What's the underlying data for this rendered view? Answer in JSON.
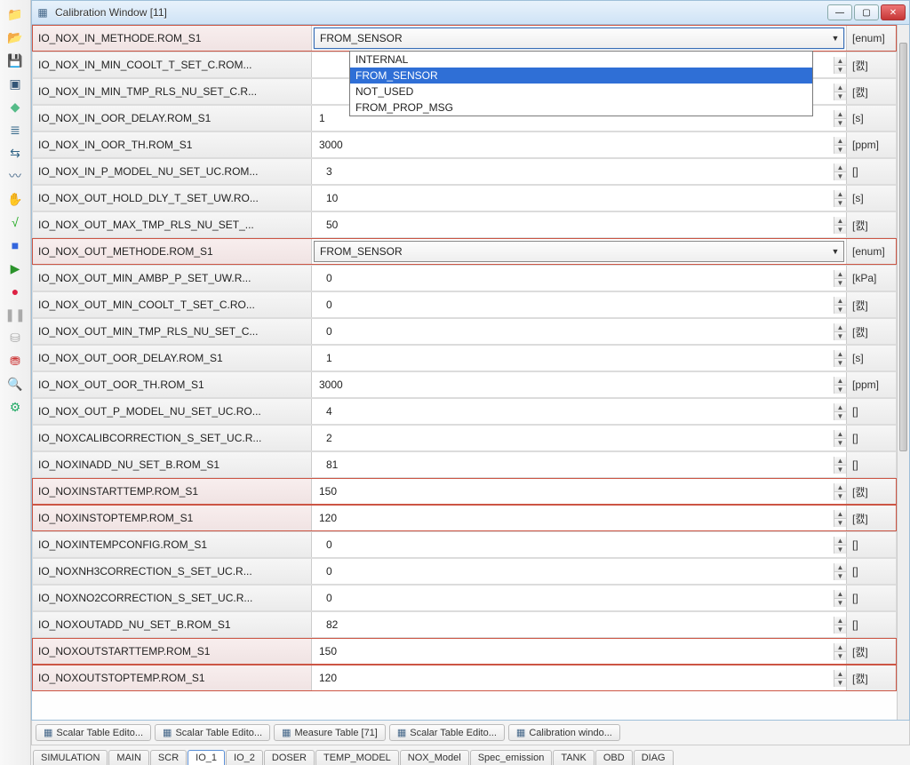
{
  "window": {
    "title": "Calibration Window [11]"
  },
  "toolbar_icons": [
    {
      "name": "folder-icon",
      "glyph": "📁",
      "cls": "ico-folder"
    },
    {
      "name": "folder-open-icon",
      "glyph": "📂",
      "cls": "ico-folder"
    },
    {
      "name": "save-icon",
      "glyph": "💾",
      "cls": "ico-save"
    },
    {
      "name": "monitor-icon",
      "glyph": "▣",
      "cls": "ico-monitor"
    },
    {
      "name": "chip-icon",
      "glyph": "◆",
      "cls": "ico-chip"
    },
    {
      "name": "list-icon",
      "glyph": "≣",
      "cls": "ico-list"
    },
    {
      "name": "tree-icon",
      "glyph": "⇆",
      "cls": "ico-tree"
    },
    {
      "name": "wave-icon",
      "glyph": "〰",
      "cls": "ico-wave"
    },
    {
      "name": "hand-icon",
      "glyph": "✋",
      "cls": "ico-hand"
    },
    {
      "name": "check-icon",
      "glyph": "√",
      "cls": "ico-check"
    },
    {
      "name": "square-icon",
      "glyph": "■",
      "cls": "ico-square"
    },
    {
      "name": "play-icon",
      "glyph": "▶",
      "cls": "ico-play"
    },
    {
      "name": "record-icon",
      "glyph": "●",
      "cls": "ico-record"
    },
    {
      "name": "pause-icon",
      "glyph": "❚❚",
      "cls": "ico-pause"
    },
    {
      "name": "disk-icon",
      "glyph": "⛁",
      "cls": "ico-disk1"
    },
    {
      "name": "disk-red-icon",
      "glyph": "⛃",
      "cls": "ico-disk2"
    },
    {
      "name": "search-icon",
      "glyph": "🔍",
      "cls": "ico-search"
    },
    {
      "name": "gear-icon",
      "glyph": "⚙",
      "cls": "ico-gear"
    }
  ],
  "dropdown": {
    "options": [
      "INTERNAL",
      "FROM_SENSOR",
      "NOT_USED",
      "FROM_PROP_MSG"
    ],
    "selected_index": 1
  },
  "rows": [
    {
      "label": "IO_NOX_IN_METHODE.ROM_S1",
      "type": "combo",
      "value": "FROM_SENSOR",
      "unit": "[enum]",
      "hl": true,
      "open": true
    },
    {
      "label": "IO_NOX_IN_MIN_COOLT_T_SET_C.ROM...",
      "type": "num",
      "value": "",
      "unit": "[캜]",
      "hl": false
    },
    {
      "label": "IO_NOX_IN_MIN_TMP_RLS_NU_SET_C.R...",
      "type": "num",
      "value": "",
      "unit": "[캜]",
      "hl": false
    },
    {
      "label": "IO_NOX_IN_OOR_DELAY.ROM_S1",
      "type": "num",
      "value": "1",
      "unit": "[s]",
      "hl": false
    },
    {
      "label": "IO_NOX_IN_OOR_TH.ROM_S1",
      "type": "num",
      "value": "3000",
      "unit": "[ppm]",
      "hl": false
    },
    {
      "label": "IO_NOX_IN_P_MODEL_NU_SET_UC.ROM...",
      "type": "num",
      "value": "3",
      "unit": "[]",
      "hl": false,
      "indent": true
    },
    {
      "label": "IO_NOX_OUT_HOLD_DLY_T_SET_UW.RO...",
      "type": "num",
      "value": "10",
      "unit": "[s]",
      "hl": false,
      "indent": true
    },
    {
      "label": "IO_NOX_OUT_MAX_TMP_RLS_NU_SET_...",
      "type": "num",
      "value": "50",
      "unit": "[캜]",
      "hl": false,
      "indent": true
    },
    {
      "label": "IO_NOX_OUT_METHODE.ROM_S1",
      "type": "combo",
      "value": "FROM_SENSOR",
      "unit": "[enum]",
      "hl": true
    },
    {
      "label": "IO_NOX_OUT_MIN_AMBP_P_SET_UW.R...",
      "type": "num",
      "value": "0",
      "unit": "[kPa]",
      "hl": false,
      "indent": true
    },
    {
      "label": "IO_NOX_OUT_MIN_COOLT_T_SET_C.RO...",
      "type": "num",
      "value": "0",
      "unit": "[캜]",
      "hl": false,
      "indent": true
    },
    {
      "label": "IO_NOX_OUT_MIN_TMP_RLS_NU_SET_C...",
      "type": "num",
      "value": "0",
      "unit": "[캜]",
      "hl": false,
      "indent": true
    },
    {
      "label": "IO_NOX_OUT_OOR_DELAY.ROM_S1",
      "type": "num",
      "value": "1",
      "unit": "[s]",
      "hl": false,
      "indent": true
    },
    {
      "label": "IO_NOX_OUT_OOR_TH.ROM_S1",
      "type": "num",
      "value": "3000",
      "unit": "[ppm]",
      "hl": false
    },
    {
      "label": "IO_NOX_OUT_P_MODEL_NU_SET_UC.RO...",
      "type": "num",
      "value": "4",
      "unit": "[]",
      "hl": false,
      "indent": true
    },
    {
      "label": "IO_NOXCALIBCORRECTION_S_SET_UC.R...",
      "type": "num",
      "value": "2",
      "unit": "[]",
      "hl": false,
      "indent": true
    },
    {
      "label": "IO_NOXINADD_NU_SET_B.ROM_S1",
      "type": "num",
      "value": "81",
      "unit": "[]",
      "hl": false,
      "indent": true
    },
    {
      "label": "IO_NOXINSTARTTEMP.ROM_S1",
      "type": "num",
      "value": "150",
      "unit": "[캜]",
      "hl": true
    },
    {
      "label": "IO_NOXINSTOPTEMP.ROM_S1",
      "type": "num",
      "value": "120",
      "unit": "[캜]",
      "hl": true
    },
    {
      "label": "IO_NOXINTEMPCONFIG.ROM_S1",
      "type": "num",
      "value": "0",
      "unit": "[]",
      "hl": false,
      "indent": true
    },
    {
      "label": "IO_NOXNH3CORRECTION_S_SET_UC.R...",
      "type": "num",
      "value": "0",
      "unit": "[]",
      "hl": false,
      "indent": true
    },
    {
      "label": "IO_NOXNO2CORRECTION_S_SET_UC.R...",
      "type": "num",
      "value": "0",
      "unit": "[]",
      "hl": false,
      "indent": true
    },
    {
      "label": "IO_NOXOUTADD_NU_SET_B.ROM_S1",
      "type": "num",
      "value": "82",
      "unit": "[]",
      "hl": false,
      "indent": true
    },
    {
      "label": "IO_NOXOUTSTARTTEMP.ROM_S1",
      "type": "num",
      "value": "150",
      "unit": "[캜]",
      "hl": true
    },
    {
      "label": "IO_NOXOUTSTOPTEMP.ROM_S1",
      "type": "num",
      "value": "120",
      "unit": "[캜]",
      "hl": true
    }
  ],
  "window_tabs": [
    {
      "label": "Scalar Table Edito..."
    },
    {
      "label": "Scalar Table Edito..."
    },
    {
      "label": "Measure Table [71]"
    },
    {
      "label": "Scalar Table Edito..."
    },
    {
      "label": "Calibration windo..."
    }
  ],
  "bottom_tabs": [
    {
      "label": "SIMULATION"
    },
    {
      "label": "MAIN"
    },
    {
      "label": "SCR"
    },
    {
      "label": "IO_1",
      "active": true
    },
    {
      "label": "IO_2"
    },
    {
      "label": "DOSER"
    },
    {
      "label": "TEMP_MODEL"
    },
    {
      "label": "NOX_Model"
    },
    {
      "label": "Spec_emission"
    },
    {
      "label": "TANK"
    },
    {
      "label": "OBD"
    },
    {
      "label": "DIAG"
    }
  ]
}
